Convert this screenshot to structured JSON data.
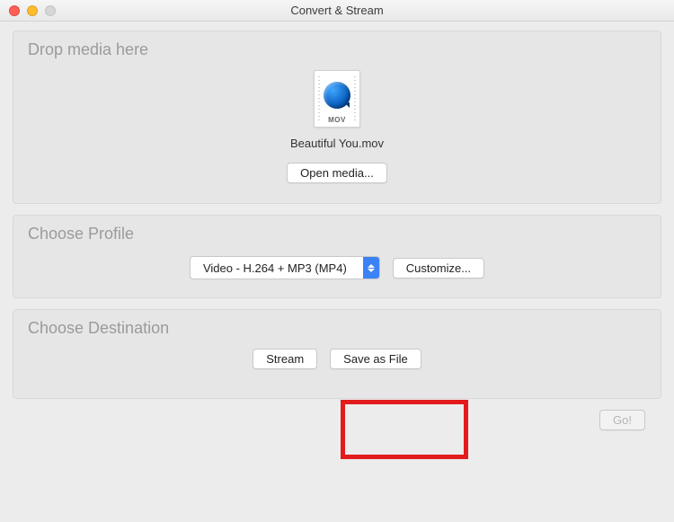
{
  "window": {
    "title": "Convert & Stream"
  },
  "drop": {
    "heading": "Drop media here",
    "file_icon_ext": "MOV",
    "filename": "Beautiful You.mov",
    "open_media_label": "Open media..."
  },
  "profile": {
    "heading": "Choose Profile",
    "selected": "Video - H.264 + MP3 (MP4)",
    "customize_label": "Customize..."
  },
  "destination": {
    "heading": "Choose Destination",
    "stream_label": "Stream",
    "save_as_file_label": "Save as File"
  },
  "footer": {
    "go_label": "Go!"
  },
  "annotation": {
    "highlight_target": "save-as-file-button"
  }
}
